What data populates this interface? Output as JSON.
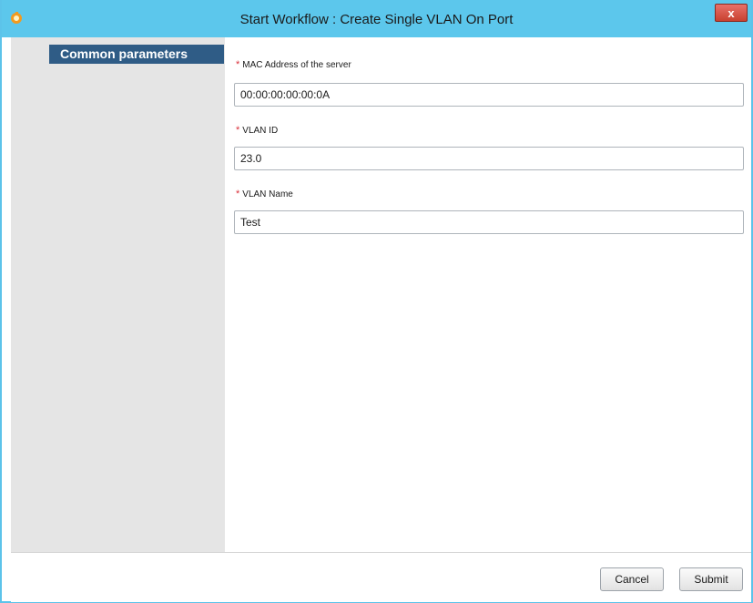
{
  "window": {
    "title": "Start Workflow : Create Single VLAN On Port",
    "close_label": "x",
    "app_icon": "orange-ring-icon"
  },
  "nav": {
    "items": [
      {
        "label": "Common parameters",
        "selected": true
      }
    ]
  },
  "form": {
    "required_mark": "*",
    "fields": [
      {
        "label": "MAC Address of the server",
        "value": "00:00:00:00:00:0A",
        "required": true
      },
      {
        "label": "VLAN ID",
        "value": "23.0",
        "required": true
      },
      {
        "label": "VLAN Name",
        "value": "Test",
        "required": true
      }
    ]
  },
  "footer": {
    "cancel_label": "Cancel",
    "submit_label": "Submit"
  },
  "colors": {
    "titlebar": "#5cc7ec",
    "nav_selected": "#2f5c86",
    "left_panel": "#e5e5e5",
    "required": "#d9303a",
    "close_button": "#c8412f"
  }
}
